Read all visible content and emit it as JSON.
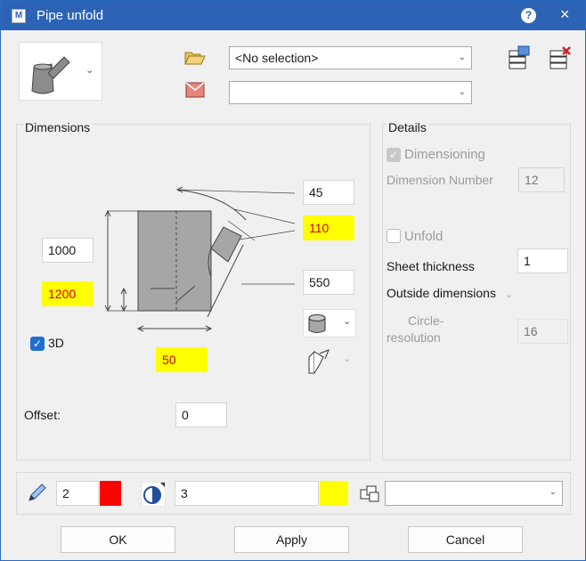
{
  "window": {
    "title": "Pipe unfold",
    "app_icon": "M",
    "help": "?",
    "close": "×"
  },
  "top": {
    "selection_combo": "<No selection>",
    "color_combo": ""
  },
  "dimensions": {
    "group_label": "Dimensions",
    "angle": "45",
    "length_a": "110",
    "height_left": "1000",
    "height_total": "1200",
    "length_b": "550",
    "width_bottom": "50",
    "threed_label": "3D",
    "offset_label": "Offset:",
    "offset_value": "0"
  },
  "details": {
    "group_label": "Details",
    "dimensioning_label": "Dimensioning",
    "dimension_number_label": "Dimension Number",
    "dimension_number_value": "12",
    "unfold_label": "Unfold",
    "sheet_thickness_label": "Sheet thickness",
    "sheet_thickness_value": "1",
    "outside_dimensions": "Outside dimensions",
    "circle_resolution_label_1": "Circle-",
    "circle_resolution_label_2": "resolution",
    "circle_resolution_value": "16"
  },
  "bottom": {
    "pen_value": "2",
    "pen_color": "#ff0000",
    "layer_value": "3",
    "layer_color": "#ffff00",
    "group_combo": ""
  },
  "buttons": {
    "ok": "OK",
    "apply": "Apply",
    "cancel": "Cancel"
  },
  "colors": {
    "titlebar": "#2c63b5",
    "highlight": "#ffff00",
    "accent": "#1f6fd1"
  }
}
